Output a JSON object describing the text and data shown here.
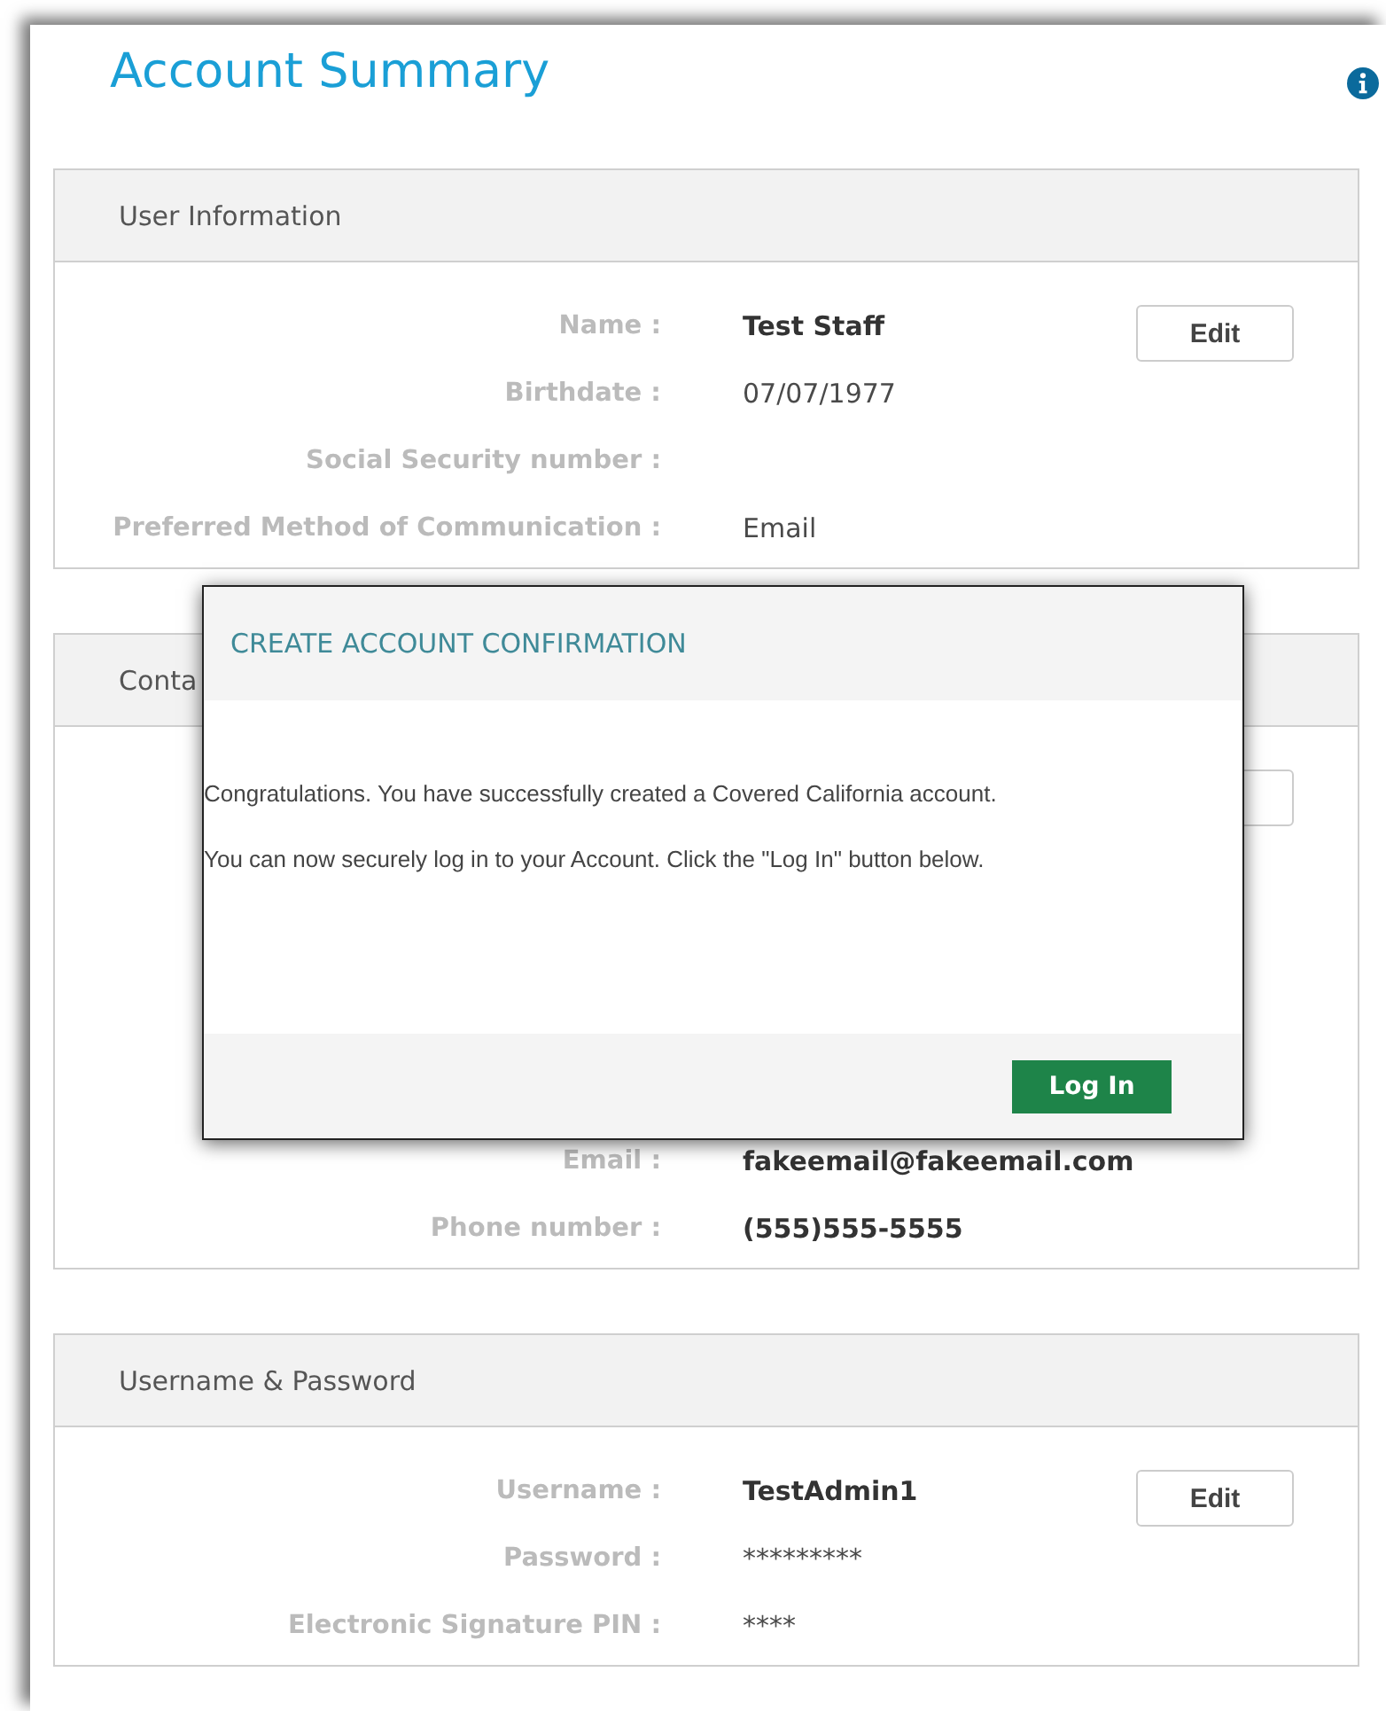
{
  "page": {
    "title": "Account Summary"
  },
  "sections": [
    {
      "title": "User Information",
      "edit_button": {
        "visible": true,
        "label": "Edit"
      },
      "fields": [
        {
          "label": "Name :",
          "value": "Test Staff",
          "bold": true
        },
        {
          "label": "Birthdate :",
          "value": "07/07/1977",
          "bold": false
        },
        {
          "label": "Social Security number :"
        },
        {
          "label": "Preferred Method of Communication :",
          "value": "Email",
          "bold": false
        }
      ]
    },
    {
      "title": "Conta",
      "edit_button": {
        "visible": true
      },
      "fields": [
        {
          "label": "Email :",
          "value": "fakeemail@fakeemail.com",
          "bold": true
        },
        {
          "label": "Phone number :",
          "value": "(555)555-5555",
          "bold": true
        }
      ]
    },
    {
      "title": "Username & Password",
      "edit_button": {
        "visible": true,
        "label": "Edit"
      },
      "fields": [
        {
          "label": "Username :",
          "value": "TestAdmin1",
          "bold": true
        },
        {
          "label": "Password :",
          "value": "*********",
          "bold": false
        },
        {
          "label": "Electronic Signature PIN :",
          "value": "****",
          "bold": false
        }
      ]
    }
  ],
  "dialog": {
    "title": "CREATE ACCOUNT CONFIRMATION",
    "paragraphs": [
      "Congratulations. You have successfully created a Covered California account.",
      "You can now securely log in to your Account. Click the \"Log In\" button below."
    ],
    "button": "Log In"
  }
}
